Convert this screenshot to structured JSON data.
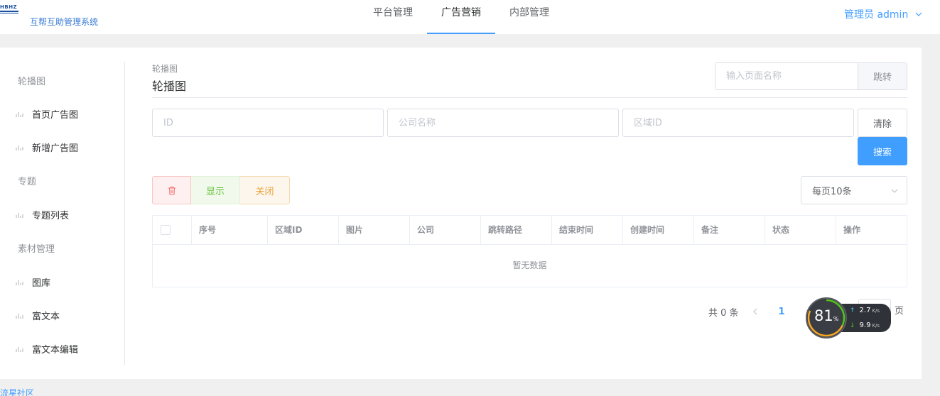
{
  "header": {
    "logo_mark": "HBHZ",
    "logo_text": "互帮互助管理系统",
    "tabs": [
      {
        "label": "平台管理"
      },
      {
        "label": "广告营销"
      },
      {
        "label": "内部管理"
      }
    ],
    "active_tab": 1,
    "user_label": "管理员 admin"
  },
  "sidebar": {
    "groups": [
      {
        "label": "轮播图"
      },
      {
        "label": "专题"
      },
      {
        "label": "素材管理"
      }
    ],
    "items": [
      {
        "label": "首页广告图"
      },
      {
        "label": "新增广告图"
      },
      {
        "label": "专题列表"
      },
      {
        "label": "图库"
      },
      {
        "label": "富文本"
      },
      {
        "label": "富文本编辑"
      }
    ]
  },
  "main": {
    "breadcrumb": "轮播图",
    "title": "轮播图",
    "jump": {
      "placeholder": "输入页面名称",
      "button": "跳转"
    },
    "filters": {
      "id_placeholder": "ID",
      "company_placeholder": "公司名称",
      "region_placeholder": "区域ID",
      "clear_label": "清除",
      "search_label": "搜索"
    },
    "actions": {
      "delete_icon": "trash-icon",
      "show_label": "显示",
      "close_label": "关闭"
    },
    "page_size": "每页10条",
    "table": {
      "columns": [
        "序号",
        "区域ID",
        "图片",
        "公司",
        "跳转路径",
        "结束时间",
        "创建时间",
        "备注",
        "状态",
        "操作"
      ],
      "rows": [],
      "empty_text": "暂无数据"
    },
    "pagination": {
      "total": "共 0 条",
      "current_page": "1",
      "goto_suffix": "页"
    }
  },
  "net_widget": {
    "percent": "81",
    "percent_sign": "%",
    "up": "2.7",
    "up_unit": "K/s",
    "down": "9.9",
    "down_unit": "K/s"
  },
  "footer": {
    "link": "流星社区"
  },
  "colors": {
    "primary": "#409eff",
    "danger": "#f56c6c",
    "success": "#67c23a",
    "warning": "#e6a23c"
  }
}
